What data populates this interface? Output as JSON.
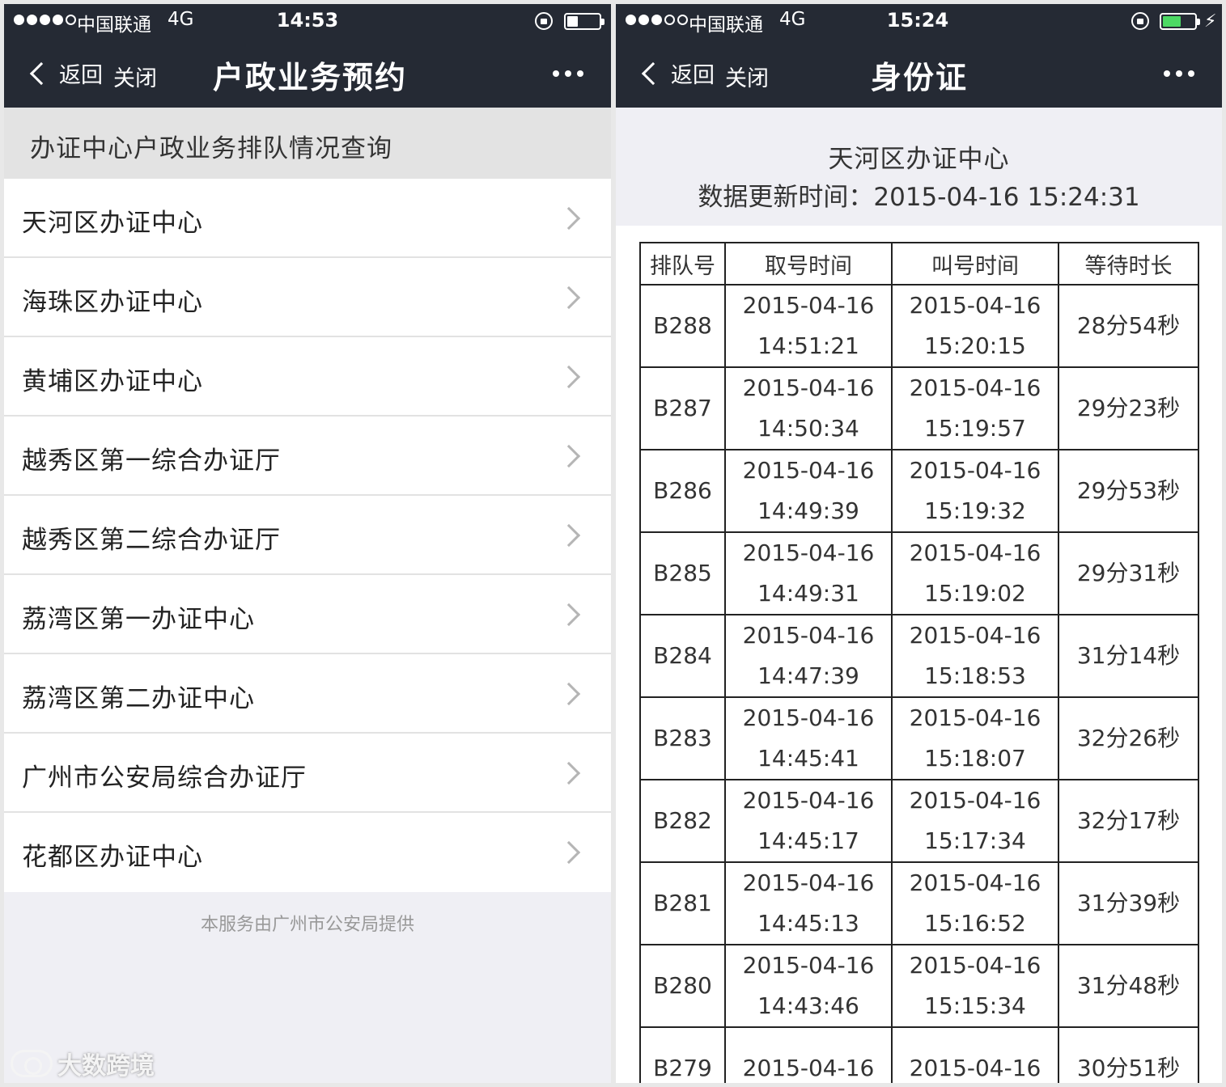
{
  "left": {
    "status": {
      "carrier": "中国联通",
      "network": "4G",
      "time": "14:53",
      "signal_filled": 4,
      "battery_level": 0.3
    },
    "nav": {
      "back_label": "返回",
      "close_label": "关闭",
      "title": "户政业务预约"
    },
    "section_header": "办证中心户政业务排队情况查询",
    "items": [
      {
        "label": "天河区办证中心"
      },
      {
        "label": "海珠区办证中心"
      },
      {
        "label": "黄埔区办证中心"
      },
      {
        "label": "越秀区第一综合办证厅"
      },
      {
        "label": "越秀区第二综合办证厅"
      },
      {
        "label": "荔湾区第一办证中心"
      },
      {
        "label": "荔湾区第二办证中心"
      },
      {
        "label": "广州市公安局综合办证厅"
      },
      {
        "label": "花都区办证中心"
      }
    ],
    "footer": "本服务由广州市公安局提供",
    "watermark": "大数跨境"
  },
  "right": {
    "status": {
      "carrier": "中国联通",
      "network": "4G",
      "time": "15:24",
      "signal_filled": 3,
      "battery_level": 0.5,
      "charging": true,
      "battery_color": "#4cd964"
    },
    "nav": {
      "back_label": "返回",
      "close_label": "关闭",
      "title": "身份证"
    },
    "center_name": "天河区办证中心",
    "update_time": "数据更新时间：2015-04-16 15:24:31",
    "table": {
      "headers": [
        "排队号",
        "取号时间",
        "叫号时间",
        "等待时长"
      ],
      "rows": [
        {
          "no": "B288",
          "take_date": "2015-04-16",
          "take_time": "14:51:21",
          "call_date": "2015-04-16",
          "call_time": "15:20:15",
          "wait": "28分54秒"
        },
        {
          "no": "B287",
          "take_date": "2015-04-16",
          "take_time": "14:50:34",
          "call_date": "2015-04-16",
          "call_time": "15:19:57",
          "wait": "29分23秒"
        },
        {
          "no": "B286",
          "take_date": "2015-04-16",
          "take_time": "14:49:39",
          "call_date": "2015-04-16",
          "call_time": "15:19:32",
          "wait": "29分53秒"
        },
        {
          "no": "B285",
          "take_date": "2015-04-16",
          "take_time": "14:49:31",
          "call_date": "2015-04-16",
          "call_time": "15:19:02",
          "wait": "29分31秒"
        },
        {
          "no": "B284",
          "take_date": "2015-04-16",
          "take_time": "14:47:39",
          "call_date": "2015-04-16",
          "call_time": "15:18:53",
          "wait": "31分14秒"
        },
        {
          "no": "B283",
          "take_date": "2015-04-16",
          "take_time": "14:45:41",
          "call_date": "2015-04-16",
          "call_time": "15:18:07",
          "wait": "32分26秒"
        },
        {
          "no": "B282",
          "take_date": "2015-04-16",
          "take_time": "14:45:17",
          "call_date": "2015-04-16",
          "call_time": "15:17:34",
          "wait": "32分17秒"
        },
        {
          "no": "B281",
          "take_date": "2015-04-16",
          "take_time": "14:45:13",
          "call_date": "2015-04-16",
          "call_time": "15:16:52",
          "wait": "31分39秒"
        },
        {
          "no": "B280",
          "take_date": "2015-04-16",
          "take_time": "14:43:46",
          "call_date": "2015-04-16",
          "call_time": "15:15:34",
          "wait": "31分48秒"
        },
        {
          "no": "B279",
          "take_date": "2015-04-16",
          "take_time": "",
          "call_date": "2015-04-16",
          "call_time": "",
          "wait": "30分51秒"
        }
      ]
    }
  }
}
